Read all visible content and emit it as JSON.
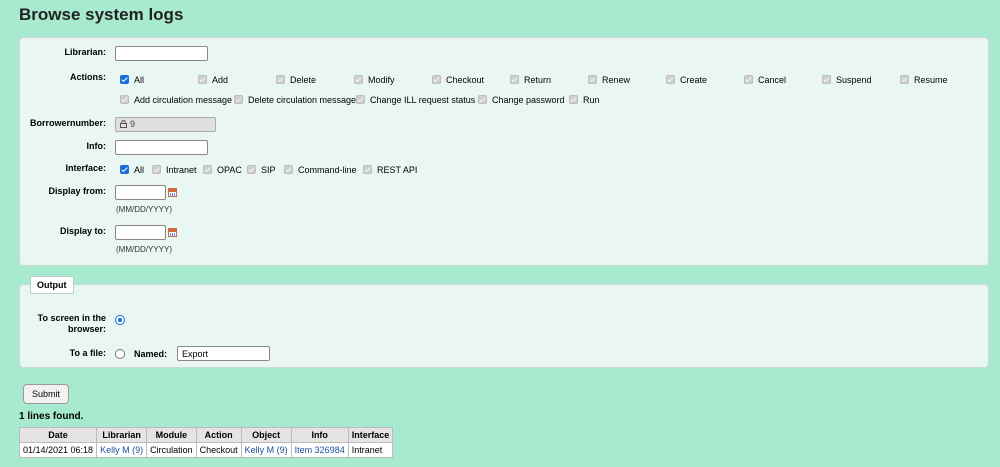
{
  "page_title": "Browse system logs",
  "criteria": {
    "librarian_label": "Librarian:",
    "librarian_value": "",
    "actions_label": "Actions:",
    "actions": [
      {
        "label": "All",
        "checked": true
      },
      {
        "label": "Add",
        "checked": false
      },
      {
        "label": "Delete",
        "checked": false
      },
      {
        "label": "Modify",
        "checked": false
      },
      {
        "label": "Checkout",
        "checked": false
      },
      {
        "label": "Return",
        "checked": false
      },
      {
        "label": "Renew",
        "checked": false
      },
      {
        "label": "Create",
        "checked": false
      },
      {
        "label": "Cancel",
        "checked": false
      },
      {
        "label": "Suspend",
        "checked": false
      },
      {
        "label": "Resume",
        "checked": false
      },
      {
        "label": "Add circulation message",
        "checked": false
      },
      {
        "label": "Delete circulation message",
        "checked": false
      },
      {
        "label": "Change ILL request status",
        "checked": false
      },
      {
        "label": "Change password",
        "checked": false
      },
      {
        "label": "Run",
        "checked": false
      }
    ],
    "borrowernumber_label": "Borrowernumber:",
    "borrowernumber_value": "9",
    "info_label": "Info:",
    "info_value": "",
    "interface_label": "Interface:",
    "interfaces": [
      {
        "label": "All",
        "checked": true
      },
      {
        "label": "Intranet",
        "checked": false
      },
      {
        "label": "OPAC",
        "checked": false
      },
      {
        "label": "SIP",
        "checked": false
      },
      {
        "label": "Command-line",
        "checked": false
      },
      {
        "label": "REST API",
        "checked": false
      }
    ],
    "display_from_label": "Display from:",
    "display_from_value": "",
    "display_to_label": "Display to:",
    "display_to_value": "",
    "date_hint": "(MM/DD/YYYY)"
  },
  "output": {
    "legend": "Output",
    "screen_label": "To screen in the browser:",
    "screen_selected": true,
    "file_label": "To a file:",
    "named_label": "Named:",
    "named_value": "Export"
  },
  "submit_label": "Submit",
  "results_summary": "1 lines found.",
  "table": {
    "headers": [
      "Date",
      "Librarian",
      "Module",
      "Action",
      "Object",
      "Info",
      "Interface"
    ],
    "rows": [
      [
        "01/14/2021 06:18",
        "Kelly M (9)",
        "Circulation",
        "Checkout",
        "Kelly M (9)",
        "Item 326984",
        "Intranet"
      ]
    ]
  },
  "colors": {
    "background": "#a8ead0",
    "checkbox_checked": "#1a6ed8",
    "link": "#1a4f99"
  },
  "icons": {
    "calendar": "calendar-icon",
    "lock": "lock-icon"
  }
}
